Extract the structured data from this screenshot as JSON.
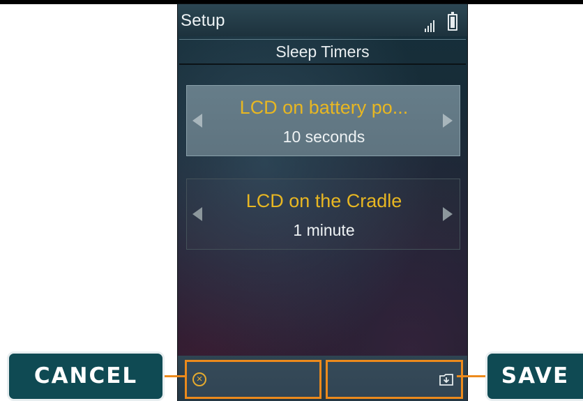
{
  "status_bar": {
    "app_title": "Setup",
    "signal_icon": "signal-bars-icon",
    "battery_icon": "battery-icon"
  },
  "page": {
    "title": "Sleep Timers"
  },
  "settings": [
    {
      "name": "LCD on battery po...",
      "value": "10 seconds",
      "selected": true
    },
    {
      "name": "LCD on the Cradle",
      "value": "1 minute",
      "selected": false
    }
  ],
  "soft_keys": {
    "left_icon": "cancel-circle-icon",
    "right_icon": "save-folder-icon"
  },
  "callouts": {
    "cancel_label": "CANCEL",
    "save_label": "SAVE"
  },
  "colors": {
    "accent": "#ec8a1c",
    "setting_name": "#e8b722",
    "callout_bg": "#0f4a53"
  }
}
